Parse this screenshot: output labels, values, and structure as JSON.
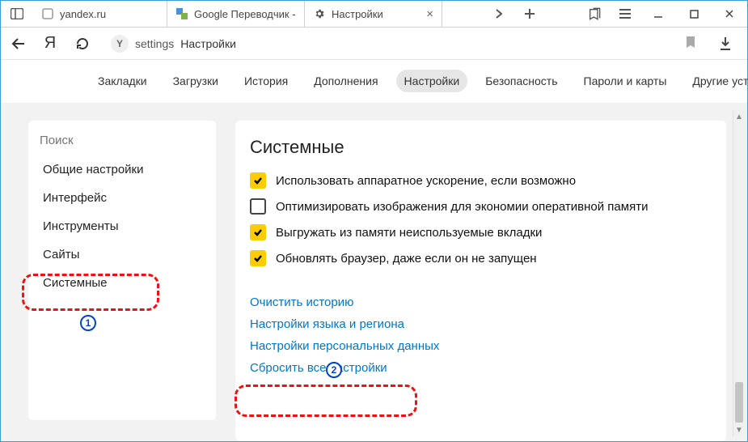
{
  "tabs": [
    {
      "title": "yandex.ru"
    },
    {
      "title": "Google Переводчик -"
    },
    {
      "title": "Настройки"
    }
  ],
  "address": {
    "path": "settings",
    "page": "Настройки"
  },
  "topnav": {
    "items": [
      "Закладки",
      "Загрузки",
      "История",
      "Дополнения",
      "Настройки",
      "Безопасность",
      "Пароли и карты",
      "Другие устройства"
    ],
    "active": "Настройки"
  },
  "sidebar": {
    "search_placeholder": "Поиск",
    "items": [
      "Общие настройки",
      "Интерфейс",
      "Инструменты",
      "Сайты",
      "Системные"
    ]
  },
  "panel": {
    "title": "Системные",
    "options": [
      {
        "checked": true,
        "label": "Использовать аппаратное ускорение, если возможно"
      },
      {
        "checked": false,
        "label": "Оптимизировать изображения для экономии оперативной памяти"
      },
      {
        "checked": true,
        "label": "Выгружать из памяти неиспользуемые вкладки"
      },
      {
        "checked": true,
        "label": "Обновлять браузер, даже если он не запущен"
      }
    ],
    "links": [
      "Очистить историю",
      "Настройки языка и региона",
      "Настройки персональных данных",
      "Сбросить все настройки"
    ]
  },
  "annotations": {
    "b1": "1",
    "b2": "2"
  }
}
